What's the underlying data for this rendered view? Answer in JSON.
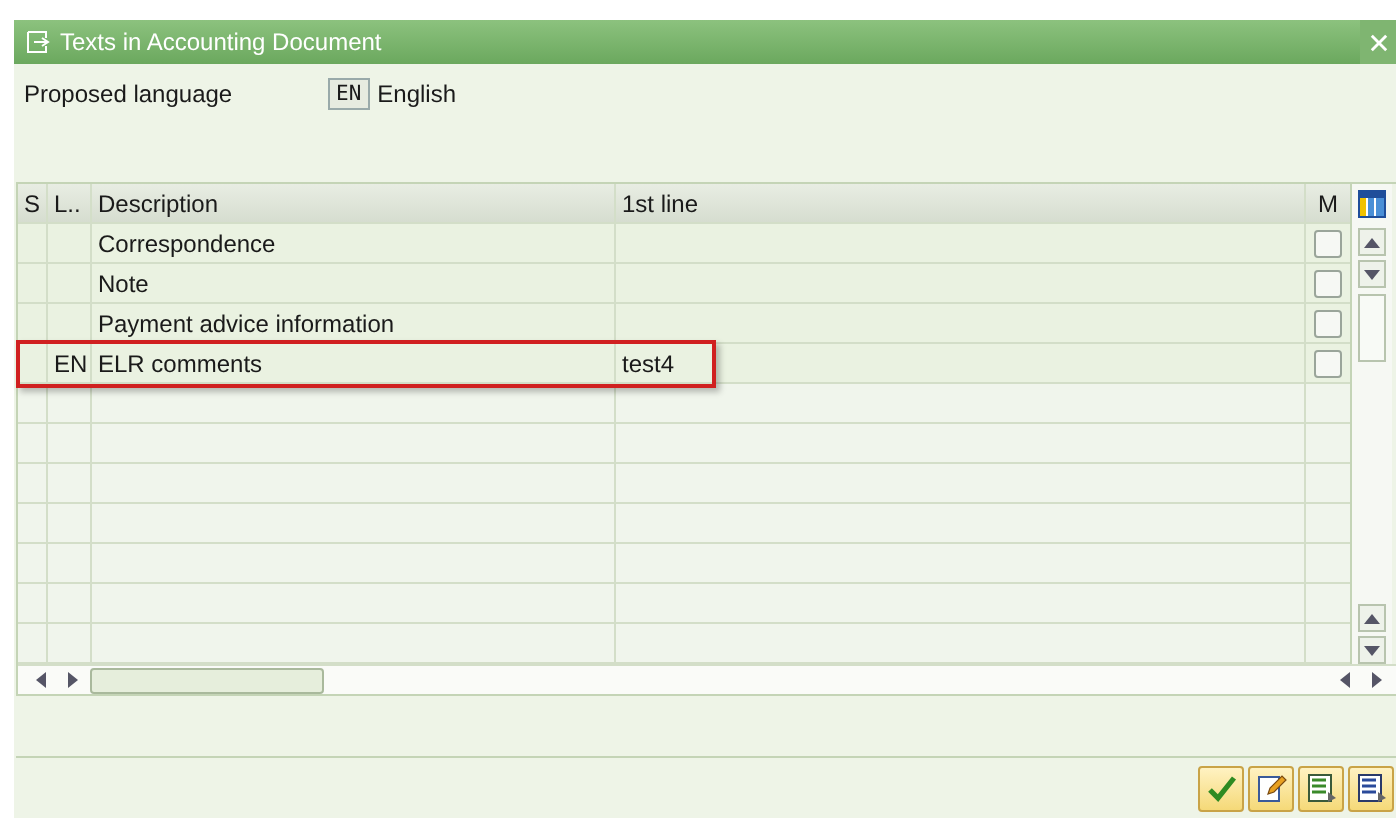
{
  "window": {
    "title": "Texts in Accounting Document"
  },
  "proposed_language": {
    "label": "Proposed language",
    "code": "EN",
    "name": "English"
  },
  "table": {
    "columns": [
      "S",
      "L..",
      "Description",
      "1st line",
      "M"
    ],
    "rows": [
      {
        "s": "",
        "l": "",
        "description": "Correspondence",
        "first_line": "",
        "m_checked": false,
        "highlighted": false
      },
      {
        "s": "",
        "l": "",
        "description": "Note",
        "first_line": "",
        "m_checked": false,
        "highlighted": false
      },
      {
        "s": "",
        "l": "",
        "description": "Payment advice information",
        "first_line": "",
        "m_checked": false,
        "highlighted": false
      },
      {
        "s": "",
        "l": "EN",
        "description": "ELR comments",
        "first_line": "test4",
        "m_checked": false,
        "highlighted": true
      }
    ]
  }
}
